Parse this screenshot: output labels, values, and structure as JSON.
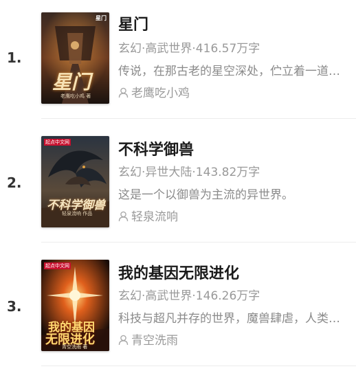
{
  "books": [
    {
      "rank": "1.",
      "title": "星门",
      "meta": "玄幻·高武世界·416.57万字",
      "desc": "传说，在那古老的星空深处，伫立着一道血与火侵染的红色之门。",
      "author": "老鹰吃小鸡",
      "cover_title": "星门",
      "cover_author": "老鹰吃小鸡 著",
      "cover_badge": "星门",
      "icon": "person-icon"
    },
    {
      "rank": "2.",
      "title": "不科学御兽",
      "meta": "玄幻·异世大陆·143.82万字",
      "desc": "这是一个以御兽为主流的异世界。",
      "author": "轻泉流响",
      "cover_title": "不科学御兽",
      "cover_author": "轻泉流响 作品",
      "cover_badge": "起点中文网",
      "icon": "person-icon"
    },
    {
      "rank": "3.",
      "title": "我的基因无限进化",
      "meta": "玄幻·高武世界·146.26万字",
      "desc": "科技与超凡并存的世界，魔兽肆虐，人类艰难求存。",
      "author": "青空洗雨",
      "cover_title_line1": "我的基因",
      "cover_title_line2": "无限进化",
      "cover_author": "青空洗雨 著",
      "cover_badge": "起点中文网",
      "icon": "person-icon"
    }
  ],
  "colors": {
    "title": "#1a1a1a",
    "meta": "#999999",
    "divider": "#ececec"
  }
}
